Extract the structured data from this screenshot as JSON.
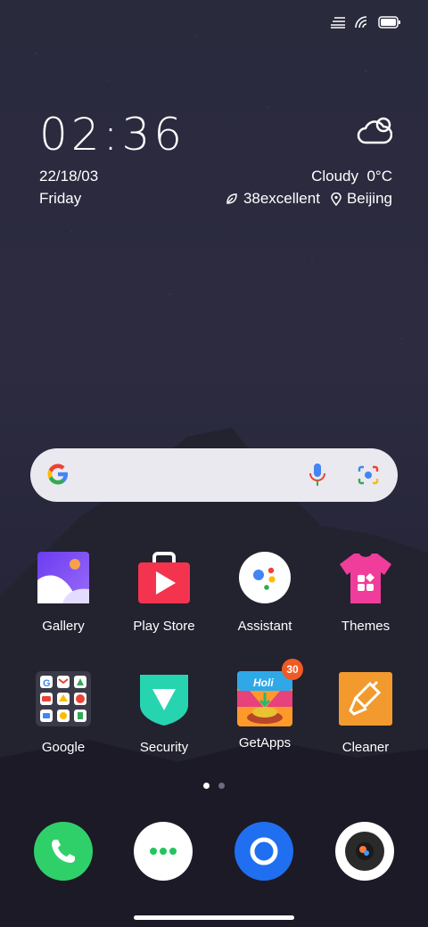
{
  "status_bar": {
    "icons": [
      "signal-icon",
      "wifi-icon",
      "battery-icon"
    ]
  },
  "clock": {
    "time": "02:36",
    "date": "22/18/03",
    "day": "Friday"
  },
  "weather": {
    "condition": "Cloudy",
    "temperature": "0°C",
    "aqi": "38excellent",
    "location": "Beijing",
    "icon": "cloud-icon"
  },
  "search": {
    "icons": [
      "google-logo-icon",
      "microphone-icon",
      "lens-camera-icon"
    ]
  },
  "apps": [
    {
      "label": "Gallery",
      "icon": "gallery-icon"
    },
    {
      "label": "Play Store",
      "icon": "play-store-icon"
    },
    {
      "label": "Assistant",
      "icon": "assistant-icon"
    },
    {
      "label": "Themes",
      "icon": "themes-icon"
    },
    {
      "label": "Google",
      "icon": "google-folder-icon"
    },
    {
      "label": "Security",
      "icon": "security-icon"
    },
    {
      "label": "GetApps",
      "icon": "getapps-icon",
      "badge": "30"
    },
    {
      "label": "Cleaner",
      "icon": "cleaner-icon"
    }
  ],
  "page_indicator": {
    "pages": 2,
    "active": 1
  },
  "dock": [
    {
      "icon": "phone-icon"
    },
    {
      "icon": "messaging-icon"
    },
    {
      "icon": "browser-icon"
    },
    {
      "icon": "camera-icon"
    }
  ],
  "colors": {
    "background": "#2a2a3d",
    "accent_badge": "#f15a24"
  }
}
